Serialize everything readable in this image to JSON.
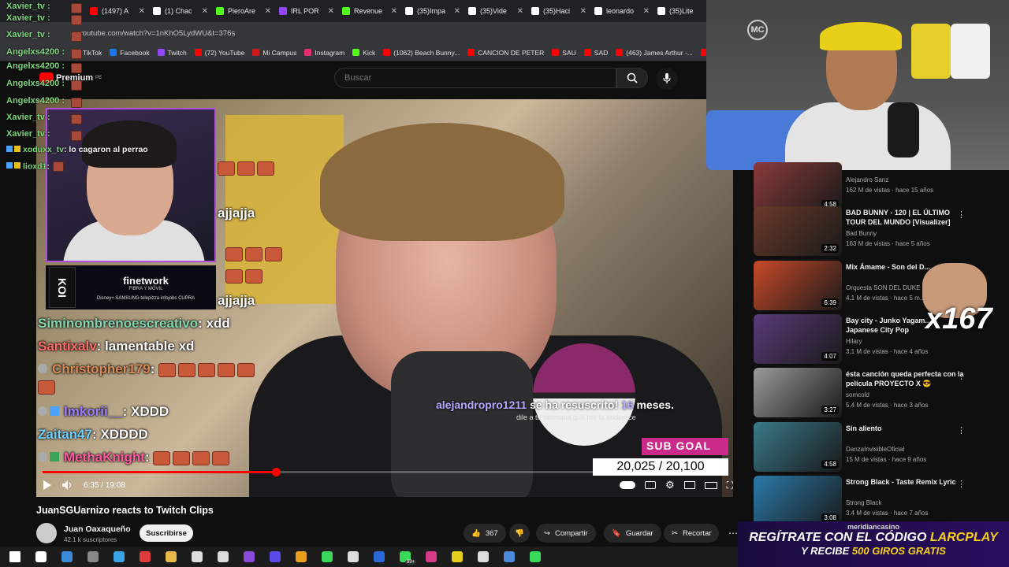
{
  "browser": {
    "tabs": [
      {
        "label": "(1497) A",
        "color": "#ff0000"
      },
      {
        "label": "(1) Chac",
        "color": "#ffffff"
      },
      {
        "label": "PieroAre",
        "color": "#53fc18"
      },
      {
        "label": "IRL POR",
        "color": "#9146ff"
      },
      {
        "label": "Revenue",
        "color": "#53fc18"
      },
      {
        "label": "(35)Impa",
        "color": "#ffffff"
      },
      {
        "label": "(35)Vide",
        "color": "#ffffff"
      },
      {
        "label": "(35)Haci",
        "color": "#ffffff"
      },
      {
        "label": "leonardo",
        "color": "#ffffff"
      },
      {
        "label": "(35)Lite",
        "color": "#ffffff"
      }
    ],
    "url": "youtube.com/watch?v=1nKhO5LydWU&t=376s",
    "bookmarks": [
      {
        "label": "TikTok",
        "color": "#ffffff"
      },
      {
        "label": "Facebook",
        "color": "#1877f2"
      },
      {
        "label": "Twitch",
        "color": "#9146ff"
      },
      {
        "label": "(72) YouTube",
        "color": "#ff0000"
      },
      {
        "label": "Mi Campus",
        "color": "#cc1a1a"
      },
      {
        "label": "Instagram",
        "color": "#e1306c"
      },
      {
        "label": "Kick",
        "color": "#53fc18"
      },
      {
        "label": "(1062) Beach Bunny...",
        "color": "#ff0000"
      },
      {
        "label": "CANCION DE PETER",
        "color": "#ff0000"
      },
      {
        "label": "SAU",
        "color": "#ff0000"
      },
      {
        "label": "SAD",
        "color": "#ff0000"
      },
      {
        "label": "(463) James Arthur -...",
        "color": "#ff0000"
      },
      {
        "label": "DRA",
        "color": "#ff0000"
      }
    ]
  },
  "youtube": {
    "logo_label": "Premium",
    "region": "PE",
    "search_placeholder": "Buscar",
    "video": {
      "title": "JuanSGUarnizo reacts to Twitch Clips",
      "time_current": "6:35",
      "time_total": "19:08",
      "time_display": "6:35 / 19:08",
      "progress_fraction": 0.344
    },
    "channel": {
      "name": "Juan Oaxaqueño",
      "subscribers": "42.1 k suscriptores",
      "subscribe_label": "Suscribirse"
    },
    "actions": {
      "likes": "367",
      "share": "Compartir",
      "save": "Guardar",
      "clip": "Recortar"
    }
  },
  "overlay": {
    "chat_small": [
      {
        "user": "xoduxx_tv",
        "text": ": lo cagaron al perrao"
      },
      {
        "user": "lioxd1",
        "text": ":"
      }
    ],
    "chat_big": [
      {
        "user": "",
        "text": "ajjajja",
        "color": "#ffffff"
      },
      {
        "user": "",
        "text": "ajjajja",
        "color": "#ffffff"
      },
      {
        "user": "Siminombrenoescreativo",
        "text": ": xdd",
        "color": "#7fd6b0"
      },
      {
        "user": "Santixalv",
        "text": ": lamentable xd",
        "color": "#ff6b6b"
      },
      {
        "user": "Christopher179",
        "text": ":",
        "color": "#d98a5a"
      },
      {
        "user": "lmkorii__",
        "text": ": XDDD",
        "color": "#9a7fff"
      },
      {
        "user": "Zaitan47",
        "text": ": XDDDD",
        "color": "#6fd3ff"
      },
      {
        "user": "MethaKnight",
        "text": ":",
        "color": "#ff5aa0"
      }
    ],
    "resub_user": "alejandropro1211",
    "resub_text": "se ha resuscrito!",
    "resub_months": "16",
    "resub_unit": "meses.",
    "resub_message": "dile a tu hermana que me la enderece",
    "sub_goal_label": "SUB GOAL",
    "sub_goal_count": "20,025 / 20,100",
    "sponsor_name": "finetwork",
    "sponsor_sub": "FIBRA Y MÓVIL",
    "sponsor_logos": "Disney+  SAMSUNG  telepizza  infojobs  CUPRA",
    "sponsor_team": "KOI",
    "left_nicks": [
      "Xavier_tv :",
      "Xavier_tv :",
      "Xavier_tv :",
      "Angelxs4200 :",
      "Angelxs4200 :",
      "Angelxs4200 :",
      "Angelxs4200 :",
      "Xavier_tv :",
      "Xavier_tv :"
    ],
    "x167": "x167",
    "right_logo": "MC"
  },
  "recommendations": [
    {
      "title": "(Videoclip Oficial)",
      "channel": "Alejandro Sanz",
      "meta": "162 M de vistas · hace 15 años",
      "duration": "4:58",
      "color": "#8a3a3a"
    },
    {
      "title": "BAD BUNNY - 120 | EL ÚLTIMO TOUR DEL MUNDO [Visualizer]",
      "channel": "Bad Bunny",
      "meta": "163 M de vistas · hace 5 años",
      "duration": "2:32",
      "color": "#6a3a2a"
    },
    {
      "title": "Mix Ámame - Son del D...",
      "channel": "Orquesta SON DEL DUKE",
      "meta": "4.1 M de vistas · hace 5 m...",
      "duration": "6:39",
      "color": "#c84a2a"
    },
    {
      "title": "Bay city - Junko Yagam... Japanese City Pop",
      "channel": "Hilary",
      "meta": "3.1 M de vistas · hace 4 años",
      "duration": "4:07",
      "color": "#5a3a7a"
    },
    {
      "title": "ésta canción queda perfecta con la película PROYECTO X 😎",
      "channel": "somcold",
      "meta": "5.4 M de vistas · hace 3 años",
      "duration": "3:27",
      "color": "#9a9a9a"
    },
    {
      "title": "Sin aliento",
      "channel": "DanzaInvisibleOficial",
      "meta": "15 M de vistas · hace 9 años",
      "duration": "4:58",
      "color": "#3a7a8a"
    },
    {
      "title": "Strong Black - Taste Remix Lyric",
      "channel": "Strong Black",
      "meta": "3.4 M de vistas · hace 7 años",
      "duration": "3:08",
      "color": "#2a7aaa"
    }
  ],
  "casino": {
    "brand": "meridiancasino",
    "line1_a": "REGÍTRATE CON EL CÓDIGO",
    "line1_b": "LARCPLAY",
    "line2_a": "Y RECIBE",
    "line2_b": "500 GIROS GRATIS"
  },
  "taskbar": {
    "badge": "99+"
  }
}
